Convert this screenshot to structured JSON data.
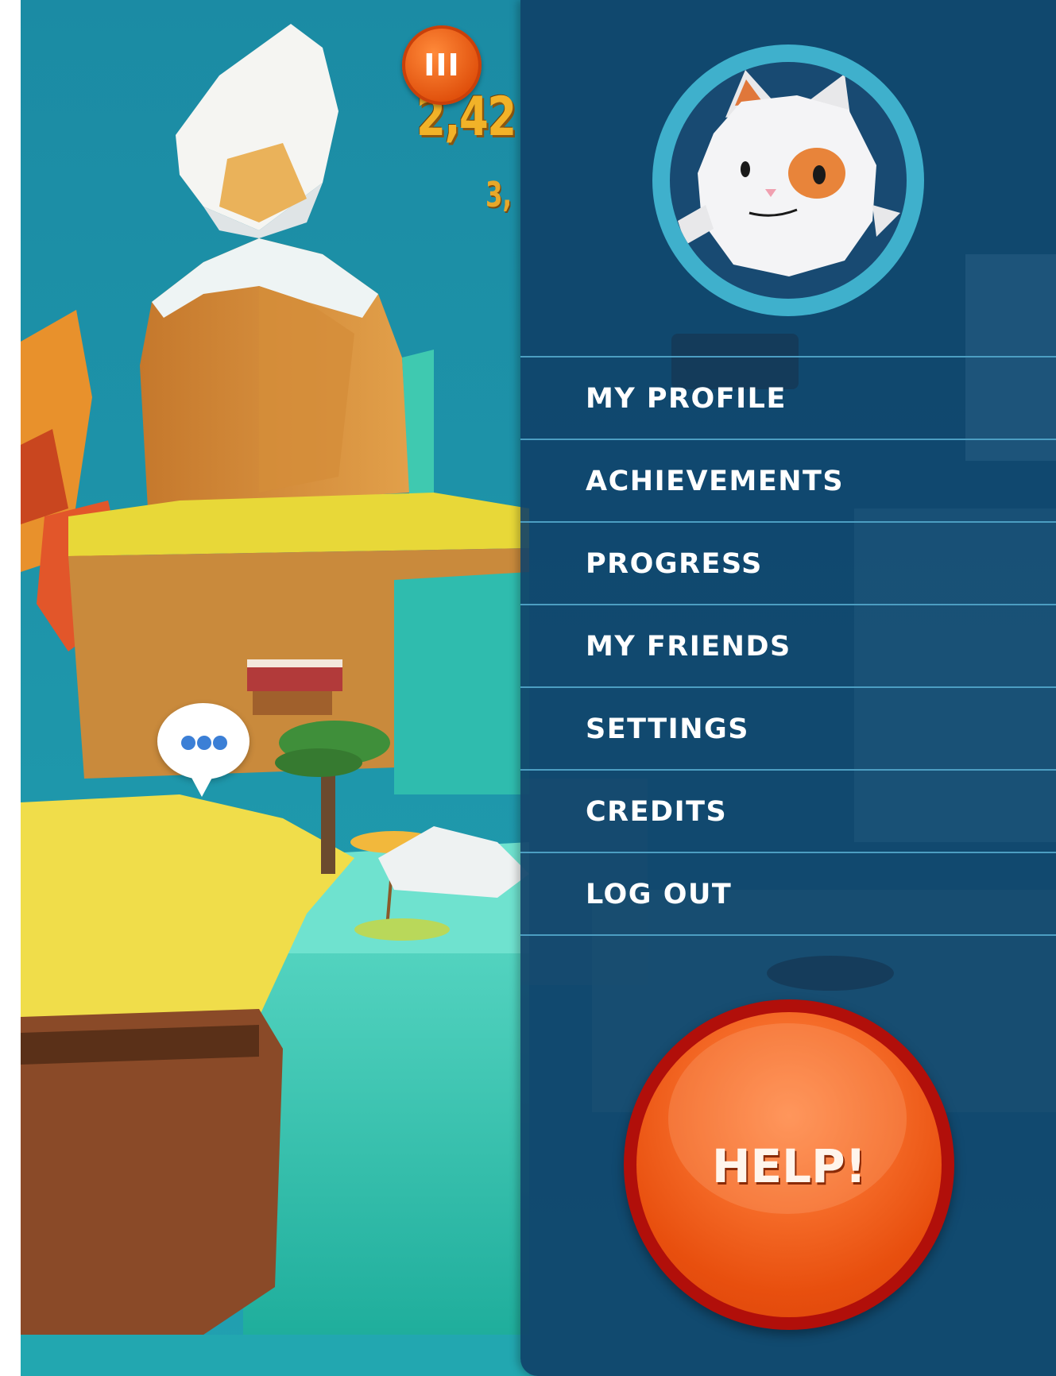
{
  "hud": {
    "pause_icon": "pause-icon",
    "pause_glyph": "III",
    "score_text": "2,42",
    "rate_text": "3,"
  },
  "scene": {
    "speech_bubble_icon": "ellipsis-icon"
  },
  "menu": {
    "avatar_icon": "cat-avatar-icon",
    "items": [
      {
        "label": "MY PROFILE"
      },
      {
        "label": "ACHIEVEMENTS"
      },
      {
        "label": "PROGRESS"
      },
      {
        "label": "MY FRIENDS"
      },
      {
        "label": "SETTINGS"
      },
      {
        "label": "CREDITS"
      },
      {
        "label": "LOG OUT"
      }
    ],
    "help_label": "HELP!"
  },
  "colors": {
    "panel": "#104068",
    "divider": "#4c9ec2",
    "help_orange": "#f56b28",
    "help_ring": "#b10f0a",
    "score_gold": "#f2b228"
  }
}
